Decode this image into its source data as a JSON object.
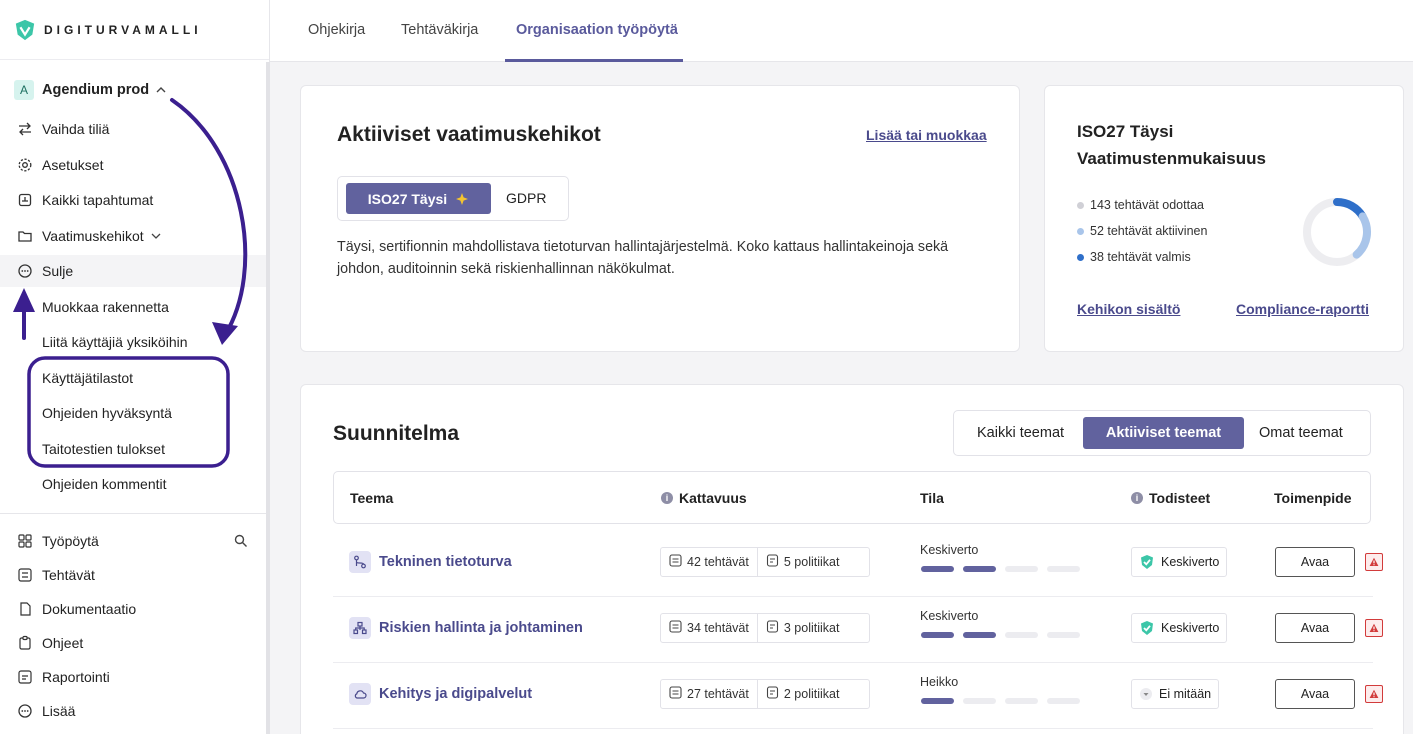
{
  "brand": {
    "logo_text": "DIGITURVAMALLI"
  },
  "sidebar": {
    "org": {
      "badge": "A",
      "name": "Agendium prod"
    },
    "menu": [
      {
        "label": "Vaihda tiliä",
        "icon": "swap-icon"
      },
      {
        "label": "Asetukset",
        "icon": "gear-icon"
      },
      {
        "label": "Kaikki tapahtumat",
        "icon": "events-icon"
      },
      {
        "label": "Vaatimuskehikot",
        "icon": "folder-icon"
      },
      {
        "label": "Sulje",
        "icon": "more-icon"
      }
    ],
    "submenu": [
      "Muokkaa rakennetta",
      "Liitä käyttäjiä yksiköihin",
      "Käyttäjätilastot",
      "Ohjeiden hyväksyntä",
      "Taitotestien tulokset",
      "Ohjeiden kommentit"
    ],
    "main_nav": [
      {
        "label": "Työpöytä",
        "icon": "grid-icon"
      },
      {
        "label": "Tehtävät",
        "icon": "tasks-icon"
      },
      {
        "label": "Dokumentaatio",
        "icon": "document-icon"
      },
      {
        "label": "Ohjeet",
        "icon": "clipboard-icon"
      },
      {
        "label": "Raportointi",
        "icon": "report-icon"
      },
      {
        "label": "Lisää",
        "icon": "more-icon"
      }
    ]
  },
  "tabs": [
    "Ohjekirja",
    "Tehtäväkirja",
    "Organisaation työpöytä"
  ],
  "frameworks_card": {
    "title": "Aktiiviset vaatimuskehikot",
    "edit_link": "Lisää tai muokkaa",
    "pills": [
      "ISO27 Täysi",
      "GDPR"
    ],
    "description": "Täysi, sertifionnin mahdollistava tietoturvan hallintajärjestelmä. Koko kattaus hallintakeinoja sekä johdon, auditoinnin sekä riskienhallinnan näkökulmat."
  },
  "compliance_card": {
    "title": "ISO27 Täysi Vaatimustenmukaisuus",
    "legend": [
      {
        "label": "143 tehtävät odottaa",
        "value": 143,
        "color": "#d0d0d6"
      },
      {
        "label": "52 tehtävät aktiivinen",
        "value": 52,
        "color": "#a9c5ea"
      },
      {
        "label": "38 tehtävät valmis",
        "value": 38,
        "color": "#2f6fc9"
      }
    ],
    "link_left": "Kehikon sisältö",
    "link_right": "Compliance-raportti"
  },
  "plan": {
    "title": "Suunnitelma",
    "filters": [
      "Kaikki teemat",
      "Aktiiviset teemat",
      "Omat teemat"
    ],
    "columns": [
      "Teema",
      "Kattavuus",
      "Tila",
      "Todisteet",
      "Toimenpide"
    ],
    "rows": [
      {
        "theme": "Tekninen tietoturva",
        "icon": "branch-icon",
        "tasks": "42 tehtävät",
        "policies": "5 politiikat",
        "status": "Keskiverto",
        "status_level": 2,
        "evidence": "Keskiverto",
        "evidence_icon": "evidence-medium-icon",
        "action": "Avaa"
      },
      {
        "theme": "Riskien hallinta ja johtaminen",
        "icon": "hierarchy-icon",
        "tasks": "34 tehtävät",
        "policies": "3 politiikat",
        "status": "Keskiverto",
        "status_level": 2,
        "evidence": "Keskiverto",
        "evidence_icon": "evidence-medium-icon",
        "action": "Avaa"
      },
      {
        "theme": "Kehitys ja digipalvelut",
        "icon": "cloud-icon",
        "tasks": "27 tehtävät",
        "policies": "2 politiikat",
        "status": "Heikko",
        "status_level": 1,
        "evidence": "Ei mitään",
        "evidence_icon": "evidence-none-icon",
        "action": "Avaa"
      }
    ]
  },
  "colors": {
    "accent": "#61629e",
    "link": "#4a4a8c",
    "annotation": "#3b1f8f",
    "warning": "#d23b3b"
  }
}
